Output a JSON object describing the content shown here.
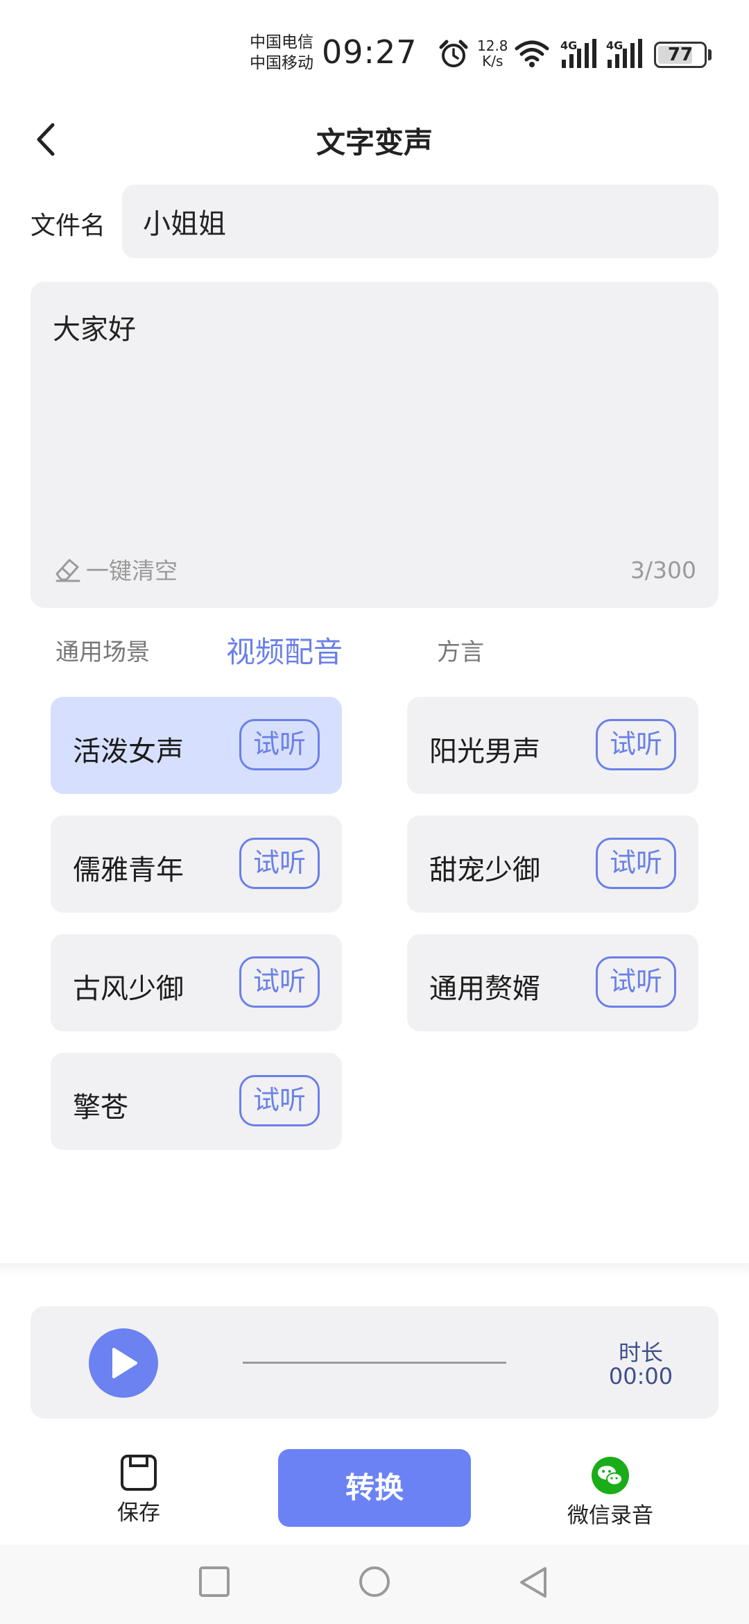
{
  "status_bar": {
    "carrier_1": "中国电信",
    "carrier_2": "中国移动",
    "time": "09:27",
    "net_speed_value": "12.8",
    "net_speed_unit": "K/s",
    "network_1": "4G",
    "network_2": "4G",
    "battery_level": "77"
  },
  "header": {
    "title": "文字变声",
    "back_icon": "chevron-left-icon"
  },
  "filename": {
    "label": "文件名",
    "value": "小姐姐"
  },
  "text_area": {
    "content": "大家好",
    "clear_label": "一键清空",
    "char_count": "3/300"
  },
  "tabs": [
    {
      "label": "通用场景",
      "active": false
    },
    {
      "label": "视频配音",
      "active": true
    },
    {
      "label": "方言",
      "active": false
    }
  ],
  "voices": [
    {
      "name": "活泼女声",
      "listen": "试听",
      "selected": true
    },
    {
      "name": "阳光男声",
      "listen": "试听",
      "selected": false
    },
    {
      "name": "儒雅青年",
      "listen": "试听",
      "selected": false
    },
    {
      "name": "甜宠少御",
      "listen": "试听",
      "selected": false
    },
    {
      "name": "古风少御",
      "listen": "试听",
      "selected": false
    },
    {
      "name": "通用赘婿",
      "listen": "试听",
      "selected": false
    },
    {
      "name": "擎苍",
      "listen": "试听",
      "selected": false
    }
  ],
  "player": {
    "duration_label": "时长",
    "duration_value": "00:00",
    "play_icon": "play-icon"
  },
  "actions": {
    "save_label": "保存",
    "convert_label": "转换",
    "wechat_label": "微信录音"
  },
  "colors": {
    "accent": "#6b82f5",
    "selected_card": "#d6e0fe",
    "card_bg": "#f1f1f3",
    "wechat_green": "#1aad19"
  }
}
